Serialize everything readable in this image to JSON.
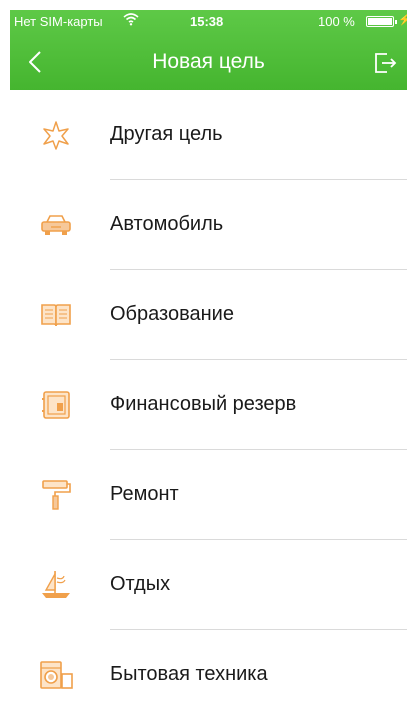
{
  "status_bar": {
    "carrier": "Нет SIM-карты",
    "time": "15:38",
    "battery_percent": "100 %",
    "battery_level": 1.0
  },
  "nav": {
    "title": "Новая цель"
  },
  "accent_color": "#f0a04b",
  "header_color": "#4cbb35",
  "goals": [
    {
      "label": "Другая цель",
      "icon": "star-icon"
    },
    {
      "label": "Автомобиль",
      "icon": "car-icon"
    },
    {
      "label": "Образование",
      "icon": "book-icon"
    },
    {
      "label": "Финансовый резерв",
      "icon": "safe-icon"
    },
    {
      "label": "Ремонт",
      "icon": "paint-roller-icon"
    },
    {
      "label": "Отдых",
      "icon": "sailboat-icon"
    },
    {
      "label": "Бытовая техника",
      "icon": "appliance-icon"
    }
  ]
}
